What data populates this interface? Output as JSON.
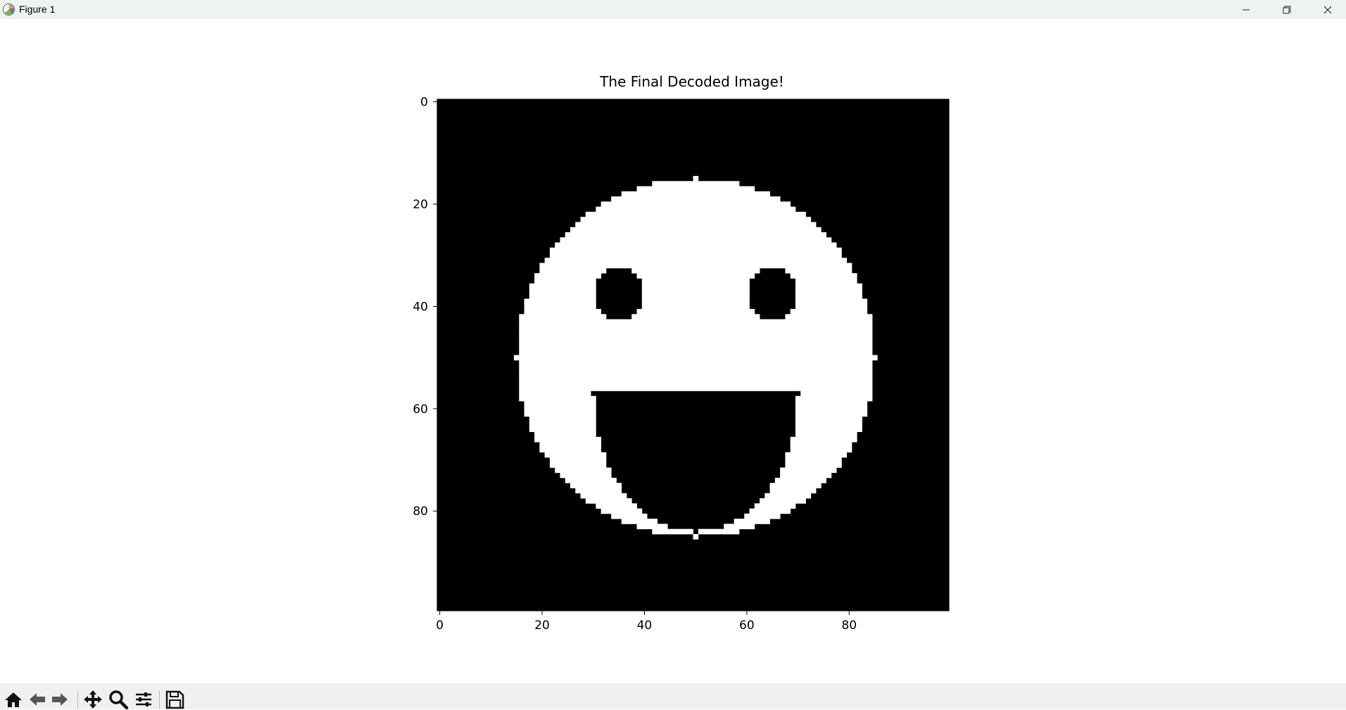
{
  "window": {
    "title": "Figure 1",
    "buttons": {
      "minimize": "minimize-icon",
      "restore": "restore-icon",
      "close": "close-icon"
    }
  },
  "toolbar": {
    "buttons": [
      {
        "name": "home-icon",
        "tooltip": "Reset original view"
      },
      {
        "name": "back-icon",
        "tooltip": "Back to previous view"
      },
      {
        "name": "forward-icon",
        "tooltip": "Forward to next view"
      },
      {
        "name": "pan-icon",
        "tooltip": "Pan axes"
      },
      {
        "name": "zoom-icon",
        "tooltip": "Zoom to rectangle"
      },
      {
        "name": "configure-subplots-icon",
        "tooltip": "Configure subplots"
      },
      {
        "name": "save-icon",
        "tooltip": "Save the figure"
      }
    ]
  },
  "chart_data": {
    "type": "heatmap",
    "title": "The Final Decoded Image!",
    "colormap": "gray",
    "image_size": [
      100,
      100
    ],
    "xticks": [
      0,
      20,
      40,
      60,
      80
    ],
    "yticks": [
      0,
      20,
      40,
      60,
      80
    ],
    "xlim": [
      -0.5,
      99.5
    ],
    "ylim": [
      99.5,
      -0.5
    ],
    "content": {
      "face": {
        "center": [
          50,
          50
        ],
        "radius": 35,
        "value": 1
      },
      "left_eye": {
        "center": [
          35,
          37.5
        ],
        "radius": 5,
        "value": 0
      },
      "right_eye": {
        "center": [
          65,
          37.5
        ],
        "radius": 5,
        "value": 0
      },
      "mouth": {
        "top_row": 57,
        "left_col": 30,
        "right_col": 70,
        "bottom_row": 84,
        "value": 0
      }
    },
    "colors": {
      "foreground": "#ffffff",
      "background": "#000000"
    }
  }
}
